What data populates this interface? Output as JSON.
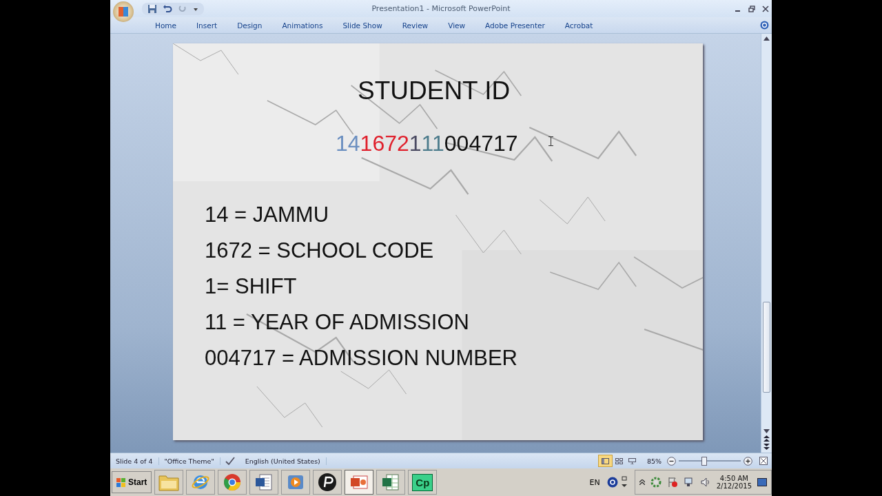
{
  "window": {
    "title": "Presentation1 - Microsoft PowerPoint"
  },
  "tabs": [
    {
      "label": "Home"
    },
    {
      "label": "Insert"
    },
    {
      "label": "Design"
    },
    {
      "label": "Animations"
    },
    {
      "label": "Slide Show"
    },
    {
      "label": "Review"
    },
    {
      "label": "View"
    },
    {
      "label": "Adobe Presenter"
    },
    {
      "label": "Acrobat"
    }
  ],
  "slide": {
    "title": "STUDENT ID",
    "id_parts": [
      {
        "text": "14",
        "color": "#6b8fc0"
      },
      {
        "text": "1672",
        "color": "#e0202c"
      },
      {
        "text": "1",
        "color": "#4a4a62"
      },
      {
        "text": "11",
        "color": "#4d7c8c"
      },
      {
        "text": "004717",
        "color": "#111111"
      }
    ],
    "lines": [
      "14 = JAMMU",
      "1672 = SCHOOL CODE",
      "1= SHIFT",
      "11 = YEAR OF ADMISSION",
      "004717 = ADMISSION NUMBER"
    ]
  },
  "status_bar": {
    "slide": "Slide 4 of 4",
    "theme": "\"Office Theme\"",
    "language": "English (United States)",
    "views": [
      {
        "kind": "normal",
        "selected": true
      },
      {
        "kind": "sorter",
        "selected": false
      },
      {
        "kind": "show",
        "selected": false
      }
    ],
    "zoom": "85%",
    "zoom_level": {
      "level": 0.4
    }
  },
  "taskbar": {
    "start": "Start",
    "apps": [
      {
        "kind": "folder",
        "selected": false
      },
      {
        "kind": "ie",
        "selected": false
      },
      {
        "kind": "chrome",
        "selected": false
      },
      {
        "kind": "word",
        "selected": false
      },
      {
        "kind": "player",
        "selected": false
      },
      {
        "kind": "circle",
        "selected": false
      },
      {
        "kind": "powerpoint",
        "selected": true
      },
      {
        "kind": "excel",
        "selected": false
      },
      {
        "kind": "label",
        "label": "Cp",
        "selected": false
      }
    ],
    "language": "EN",
    "time": "4:50 AM",
    "date": "2/12/2015"
  }
}
